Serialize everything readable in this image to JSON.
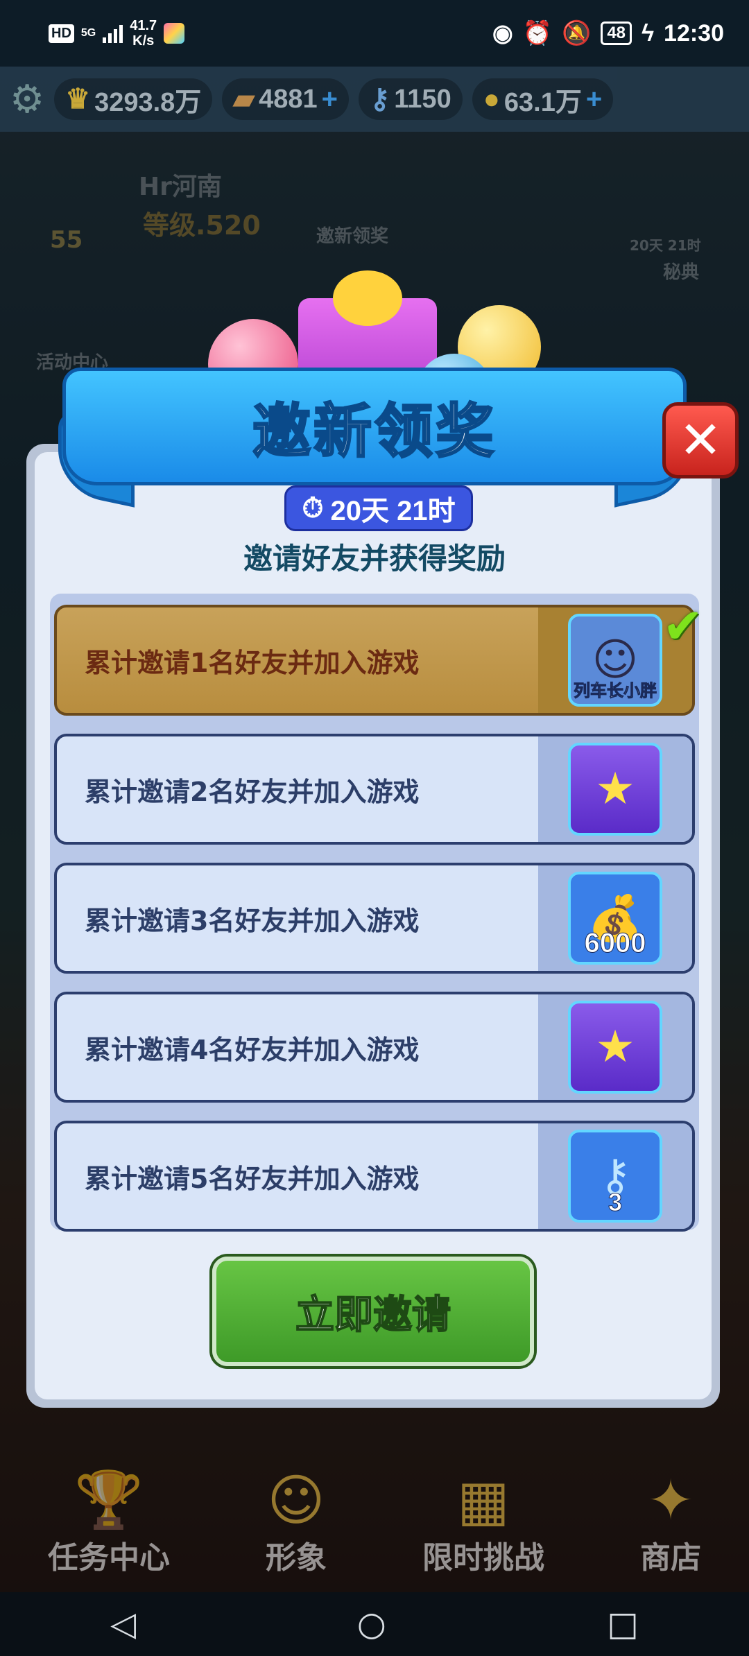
{
  "status_bar": {
    "hd": "HD",
    "network": "5G",
    "speed_value": "41.7",
    "speed_unit": "K/s",
    "battery": "48",
    "time": "12:30"
  },
  "currencies": [
    {
      "icon": "crown-icon",
      "value": "3293.8万"
    },
    {
      "icon": "hoverboard-icon",
      "value": "4881"
    },
    {
      "icon": "key-icon",
      "value": "1150"
    },
    {
      "icon": "coin-icon",
      "value": "63.1万"
    }
  ],
  "profile": {
    "name": "Hr河南",
    "level": "等级.520",
    "badge": "55"
  },
  "background_labels": {
    "invite_reward": "邀新领奖",
    "activity_center": "活动中心",
    "secret_days": "20天 21时",
    "secret_label": "秘典"
  },
  "dialog": {
    "title": "邀新领奖",
    "timer": "20天 21时",
    "subtitle": "邀请好友并获得奖励",
    "tasks": [
      {
        "label": "累计邀请1名好友并加入游戏",
        "reward": "character",
        "reward_caption": "列车长小胖",
        "completed": true
      },
      {
        "label": "累计邀请2名好友并加入游戏",
        "reward": "card",
        "reward_caption": "",
        "completed": false
      },
      {
        "label": "累计邀请3名好友并加入游戏",
        "reward": "coins",
        "reward_caption": "6000",
        "completed": false
      },
      {
        "label": "累计邀请4名好友并加入游戏",
        "reward": "card",
        "reward_caption": "",
        "completed": false
      },
      {
        "label": "累计邀请5名好友并加入游戏",
        "reward": "keys",
        "reward_caption": "3",
        "completed": false
      }
    ],
    "invite_button": "立即邀请"
  },
  "game_nav": [
    {
      "label": "任务中心",
      "icon": "trophy-icon"
    },
    {
      "label": "形象",
      "icon": "character-icon"
    },
    {
      "label": "限时挑战",
      "icon": "calendar-icon"
    },
    {
      "label": "商店",
      "icon": "shop-bag-icon"
    }
  ],
  "colors": {
    "banner": "#1a8be8",
    "close": "#e0392f",
    "timer": "#3b56e0",
    "invite_button": "#4fae32",
    "completed_row": "#c09a50"
  }
}
